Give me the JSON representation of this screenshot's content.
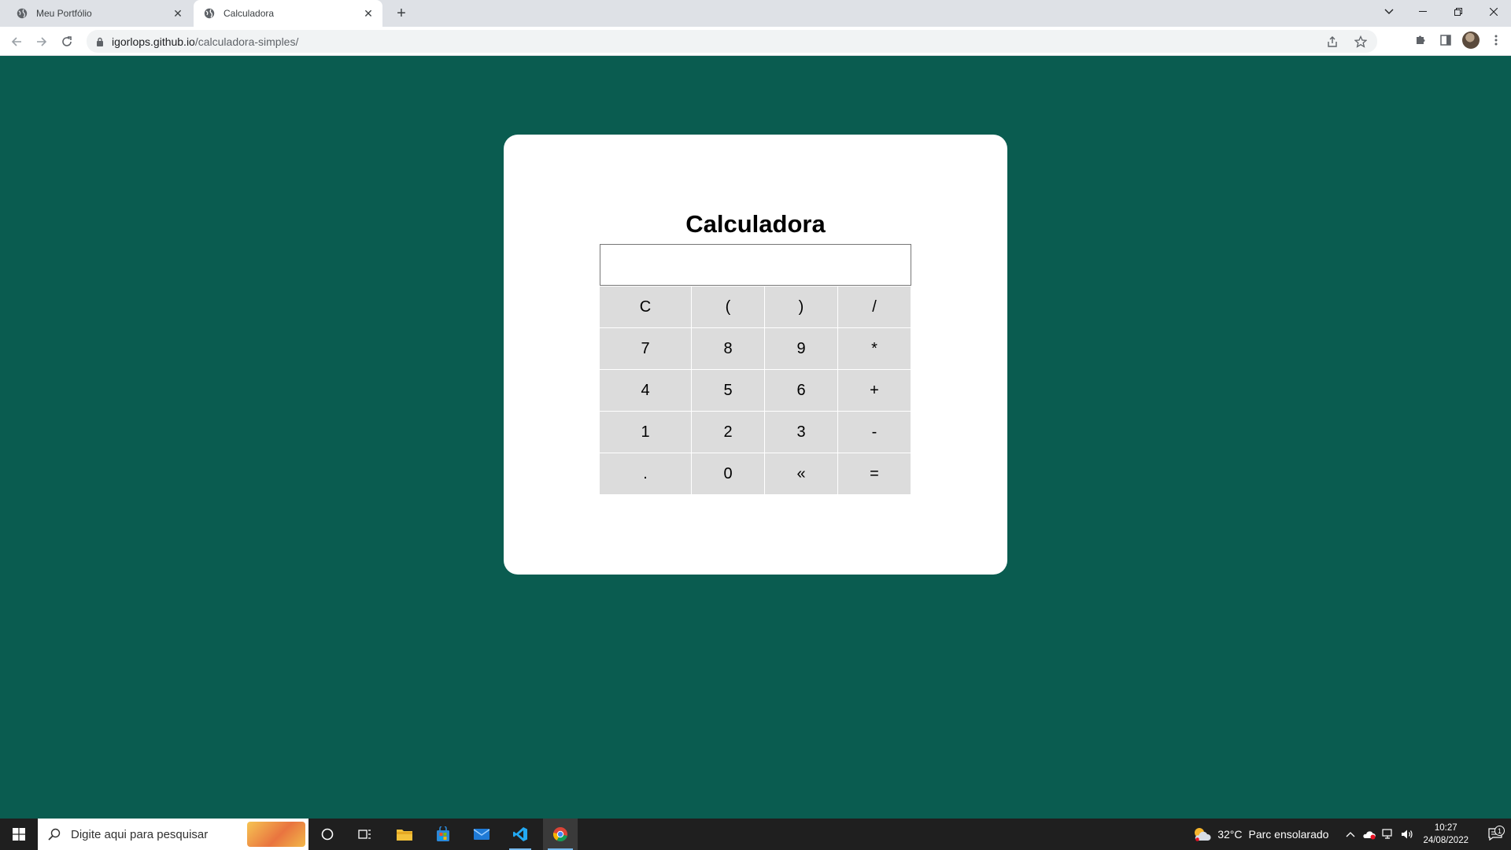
{
  "browser": {
    "tabs": [
      {
        "title": "Meu Portfólio",
        "active": false
      },
      {
        "title": "Calculadora",
        "active": true
      }
    ],
    "url_host": "igorlops.github.io",
    "url_path": "/calculadora-simples/"
  },
  "page": {
    "background_color": "#0a5c50",
    "title": "Calculadora",
    "display_value": "",
    "keys": [
      "C",
      "(",
      ")",
      "/",
      "7",
      "8",
      "9",
      "*",
      "4",
      "5",
      "6",
      "+",
      "1",
      "2",
      "3",
      "-",
      ".",
      "0",
      "«",
      "="
    ]
  },
  "taskbar": {
    "search_placeholder": "Digite aqui para pesquisar",
    "weather_temp": "32°C",
    "weather_text": "Parc ensolarado",
    "time": "10:27",
    "date": "24/08/2022",
    "notification_count": "1"
  }
}
